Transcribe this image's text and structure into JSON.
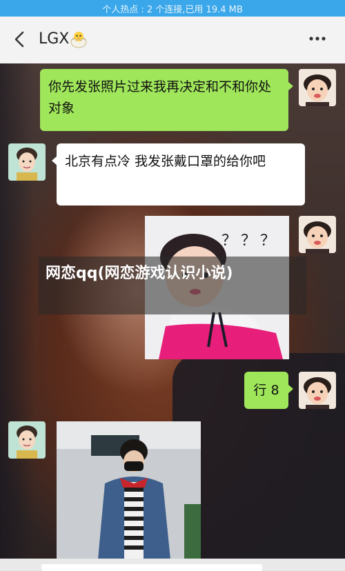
{
  "status_bar": {
    "text": "个人热点 : 2 个连接,已用 19.4 MB"
  },
  "header": {
    "title": "LGX",
    "title_emoji": "chick-icon"
  },
  "messages": [
    {
      "side": "right",
      "type": "text",
      "text": "你先发张照片过来我再决定和不和你处对象"
    },
    {
      "side": "left",
      "type": "text",
      "text": "北京有点冷 我发张戴口罩的给你吧"
    },
    {
      "side": "right",
      "type": "image",
      "image_text": "？？？"
    },
    {
      "side": "right",
      "type": "text",
      "text": "行 8"
    },
    {
      "side": "left",
      "type": "image",
      "image_text": ""
    }
  ],
  "overlay": {
    "title": "网恋qq(网恋游戏认识小说)"
  },
  "colors": {
    "status_bar": "#3aa7ea",
    "sent_bubble": "#9fe65a",
    "received_bubble": "#ffffff"
  }
}
